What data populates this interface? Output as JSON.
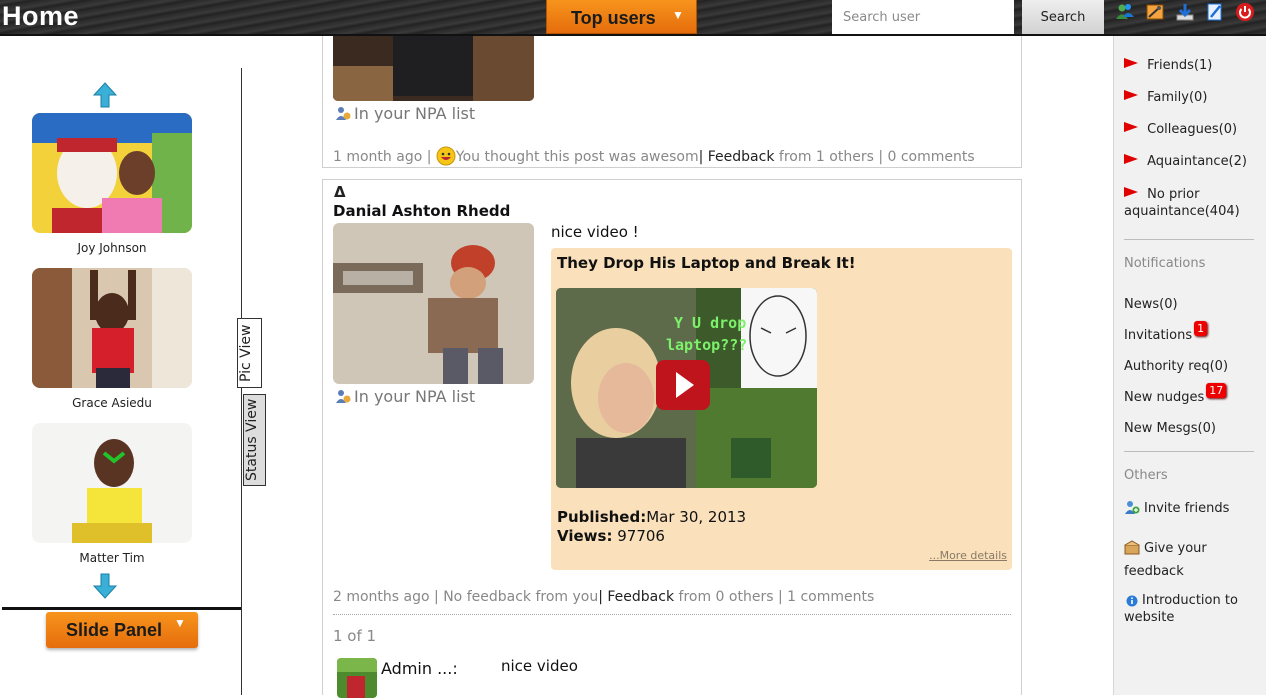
{
  "header": {
    "title": "Home",
    "top_users_label": "Top users",
    "search_placeholder": "Search user",
    "search_button": "Search",
    "icons": [
      "users-icon",
      "settings-icon",
      "download-icon",
      "edit-icon",
      "power-icon"
    ]
  },
  "left_panel": {
    "people": [
      {
        "name": "Joy Johnson"
      },
      {
        "name": "Grace Asiedu"
      },
      {
        "name": "Matter Tim"
      }
    ],
    "slide_panel_label": "Slide Panel",
    "tabs": {
      "pic_view": "Pic View",
      "status_view": "Status View"
    }
  },
  "feed": {
    "post1": {
      "npa_label": "In your NPA list",
      "time": "1 month ago",
      "reaction": "You thought this post was awesom",
      "feedback_label": "Feedback",
      "feedback_from": "from 1 others",
      "comments": "0 comments"
    },
    "post2": {
      "delta": "Δ",
      "author": "Danial Ashton Rhedd",
      "text": "nice video !",
      "npa_label": "In your NPA list",
      "video": {
        "title": "They Drop His Laptop and Break It!",
        "caption": "Y U drop laptop???",
        "published_label": "Published:",
        "published_value": "Mar 30, 2013",
        "views_label": "Views:",
        "views_value": "97706",
        "more_details": "...More details"
      },
      "time": "2 months ago",
      "feedback_status": "No feedback from you",
      "feedback_label": "Feedback",
      "feedback_from": "from 0 others",
      "comments": "1 comments",
      "pager": "1 of 1",
      "comment": {
        "author": "Admin ...:",
        "text": "nice video"
      }
    }
  },
  "right_panel": {
    "groups": [
      {
        "label": "Friends(1)"
      },
      {
        "label": "Family(0)"
      },
      {
        "label": "Colleagues(0)"
      },
      {
        "label": "Aquaintance(2)"
      },
      {
        "label_line1": "No prior",
        "label_line2": "aquaintance(404)"
      }
    ],
    "notifications_heading": "Notifications",
    "notifications": {
      "news": "News(0)",
      "invitations": "Invitations",
      "invitations_badge": "1",
      "authority": "Authority req(0)",
      "nudges": "New nudges",
      "nudges_badge": "17",
      "messages": "New Mesgs(0)"
    },
    "others_heading": "Others",
    "others": {
      "invite": "Invite friends",
      "feedback_line1": "Give your",
      "feedback_line2": "feedback",
      "intro_line1": "Introduction to",
      "intro_line2": "website"
    }
  },
  "colors": {
    "accent_orange": "#f7941d",
    "badge_red": "#ee0000",
    "flag_red": "#e00000",
    "video_card": "#fae1bc"
  }
}
